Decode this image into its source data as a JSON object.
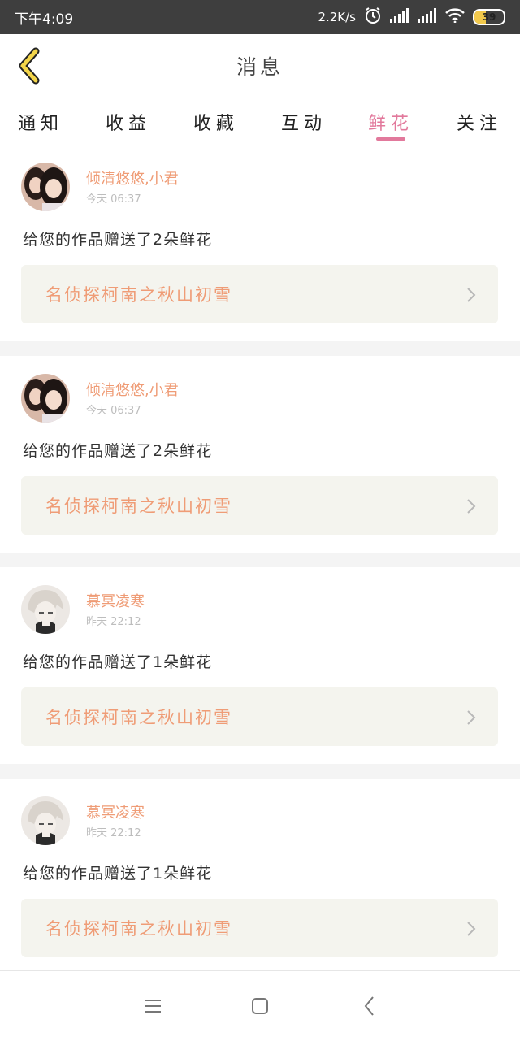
{
  "status_bar": {
    "time": "下午4:09",
    "net_speed": "2.2K/s",
    "battery_level": "39",
    "battery_fraction": 0.39
  },
  "header": {
    "title": "消息"
  },
  "tabs": [
    {
      "label": "通知"
    },
    {
      "label": "收益"
    },
    {
      "label": "收藏"
    },
    {
      "label": "互动"
    },
    {
      "label": "鲜花",
      "active": true
    },
    {
      "label": "关注"
    }
  ],
  "messages": [
    {
      "sender": "倾清悠悠,小君",
      "time": "今天 06:37",
      "text": "给您的作品赠送了2朵鲜花",
      "work_title": "名侦探柯南之秋山初雪",
      "avatar": "two-girls-photo"
    },
    {
      "sender": "倾清悠悠,小君",
      "time": "今天 06:37",
      "text": "给您的作品赠送了2朵鲜花",
      "work_title": "名侦探柯南之秋山初雪",
      "avatar": "two-girls-photo"
    },
    {
      "sender": "慕冥凌寒",
      "time": "昨天 22:12",
      "text": "给您的作品赠送了1朵鲜花",
      "work_title": "名侦探柯南之秋山初雪",
      "avatar": "anime-boy-illustration"
    },
    {
      "sender": "慕冥凌寒",
      "time": "昨天 22:12",
      "text": "给您的作品赠送了1朵鲜花",
      "work_title": "名侦探柯南之秋山初雪",
      "avatar": "anime-boy-illustration"
    }
  ],
  "nav_bar": {
    "icons": [
      "menu-icon",
      "home-square-icon",
      "back-chevron-icon"
    ]
  },
  "colors": {
    "accent": "#e2799c",
    "sender_orange": "#ef9c76",
    "back_icon": "#f3d54a"
  }
}
